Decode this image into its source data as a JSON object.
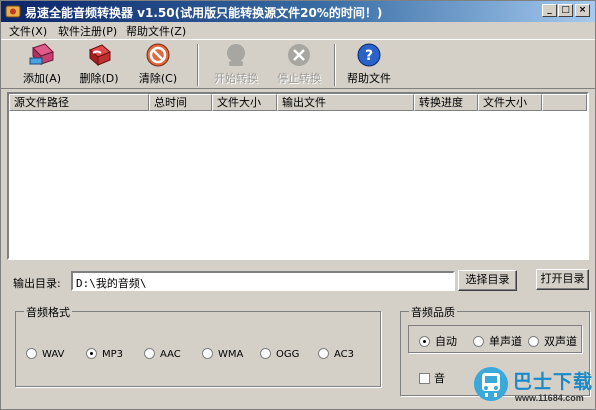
{
  "window": {
    "title": "易速全能音频转换器 v1.50(试用版只能转换源文件20%的时间！)",
    "controls": [
      "_",
      "□",
      "×"
    ]
  },
  "menu": [
    {
      "label": "文件(X)"
    },
    {
      "label": "软件注册(P)"
    },
    {
      "label": "帮助文件(Z)"
    }
  ],
  "toolbar": {
    "add": {
      "label": "添加(A)",
      "icon": "add-eraser-icon"
    },
    "delete": {
      "label": "删除(D)",
      "icon": "delete-eraser-icon"
    },
    "clear": {
      "label": "清除(C)",
      "icon": "clear-circle-icon"
    },
    "start": {
      "label": "开始转换",
      "icon": "start-convert-icon"
    },
    "stop": {
      "label": "停止转换",
      "icon": "stop-convert-icon"
    },
    "help": {
      "label": "帮助文件",
      "icon": "help-question-icon"
    }
  },
  "list": {
    "columns": [
      "源文件路径",
      "总时间",
      "文件大小",
      "输出文件",
      "转换进度",
      "文件大小"
    ],
    "rows": []
  },
  "output": {
    "label": "输出目录:",
    "path": "D:\\我的音频\\",
    "choose_button": "选择目录",
    "open_button": "打开目录"
  },
  "format": {
    "title": "音频格式",
    "options": [
      "WAV",
      "MP3",
      "AAC",
      "WMA",
      "OGG",
      "AC3"
    ],
    "selected": "MP3"
  },
  "quality": {
    "title": "音频品质",
    "options": [
      "自动",
      "单声道",
      "双声道"
    ],
    "selected": "自动",
    "checkbox_label": "音"
  },
  "watermark": {
    "name": "巴士下载",
    "url": "www.11684.com"
  },
  "colors": {
    "titlebar_start": "#0a246a",
    "titlebar_end": "#a6caf0",
    "face": "#d4d0c8"
  }
}
